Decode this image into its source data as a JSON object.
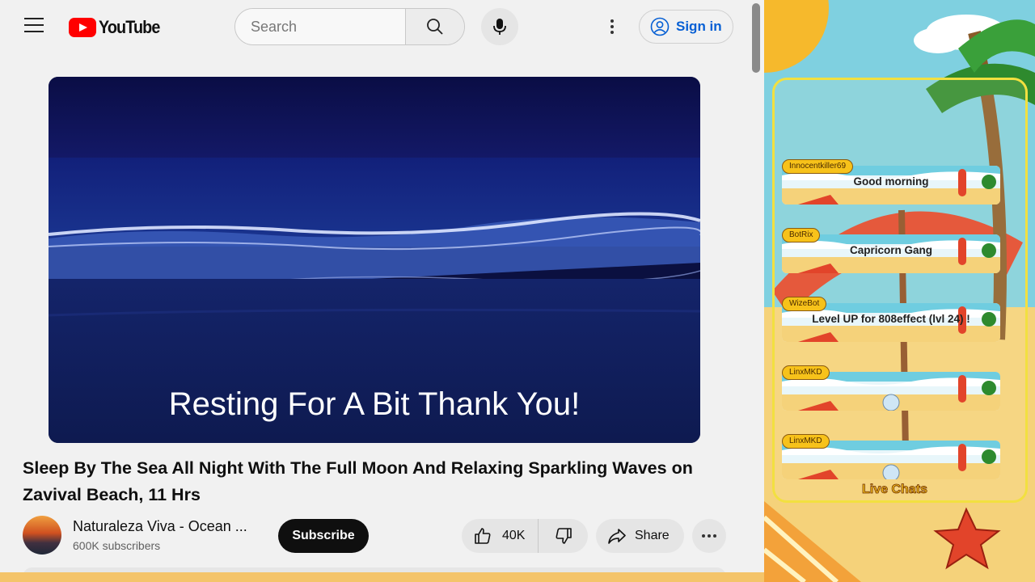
{
  "header": {
    "logo_text": "YouTube",
    "search_placeholder": "Search",
    "signin_label": "Sign in"
  },
  "player": {
    "caption": "Resting For A Bit Thank You!"
  },
  "video": {
    "title": "Sleep By The Sea All Night With The Full Moon And Relaxing Sparkling Waves on Zavival Beach, 11 Hrs"
  },
  "channel": {
    "name": "Naturaleza Viva - Ocean ...",
    "subscribers": "600K subscribers",
    "subscribe_label": "Subscribe"
  },
  "actions": {
    "likes": "40K",
    "share_label": "Share"
  },
  "chat": {
    "footer": "Live Chats",
    "messages": [
      {
        "user": "Innocentkiller69",
        "text": "Good morning"
      },
      {
        "user": "BotRix",
        "text": "Capricorn Gang"
      },
      {
        "user": "WizeBot",
        "text": "Level UP for 808effect (lvl 24) !"
      },
      {
        "user": "LinxMKD",
        "text": ""
      },
      {
        "user": "LinxMKD",
        "text": ""
      }
    ]
  },
  "colors": {
    "brand_red": "#ff0000",
    "link_blue": "#065fd4",
    "chat_frame": "#f2e040",
    "username_badge": "#f7c21a"
  },
  "icons": [
    "menu-icon",
    "youtube-logo-icon",
    "search-icon",
    "mic-icon",
    "more-vert-icon",
    "account-icon",
    "like-icon",
    "dislike-icon",
    "share-icon",
    "more-horiz-icon"
  ]
}
